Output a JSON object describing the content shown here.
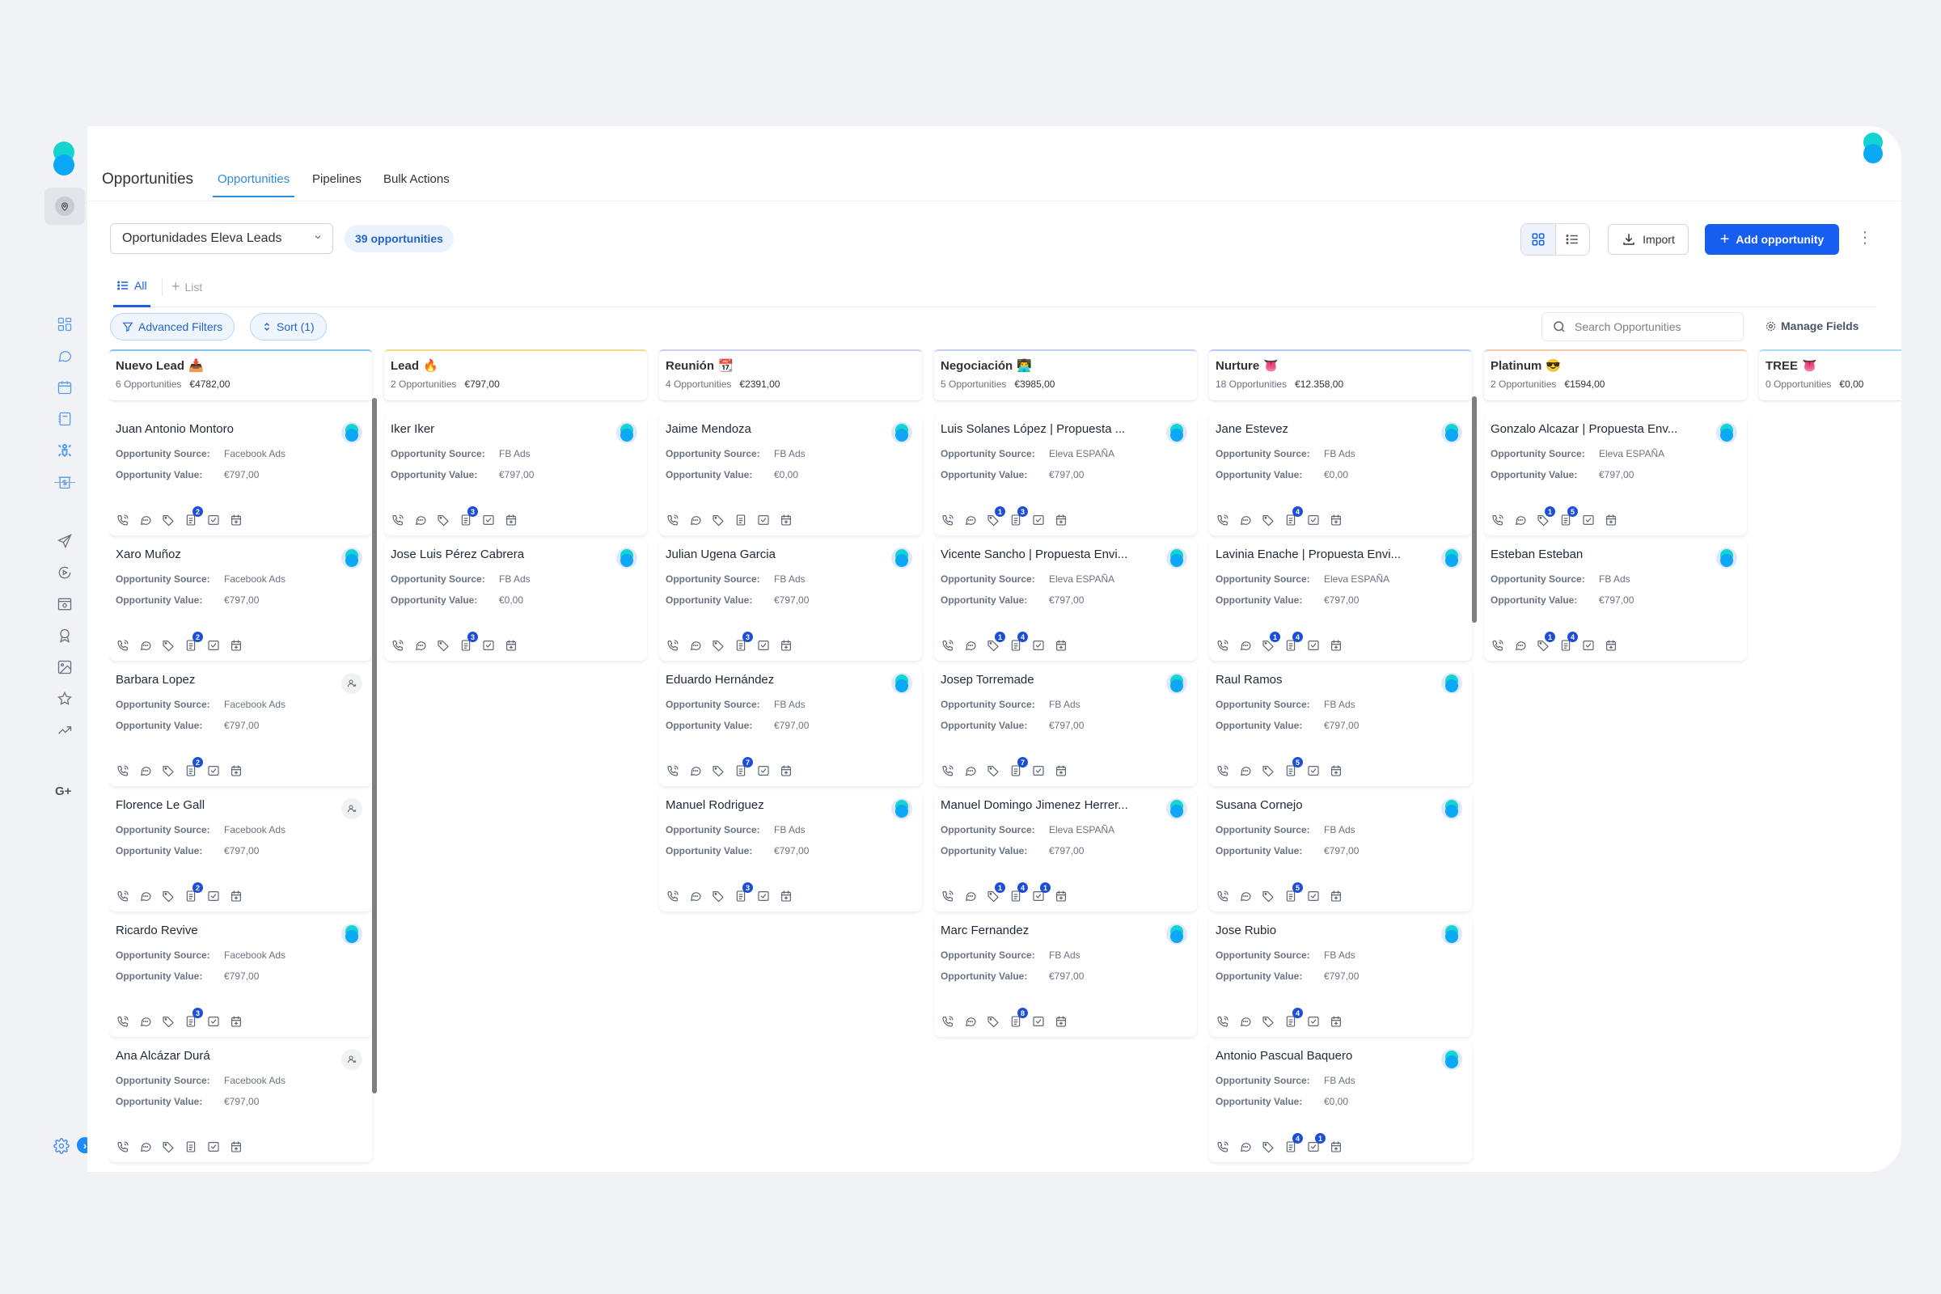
{
  "app": {
    "page_title": "Opportunities",
    "tabs": [
      {
        "label": "Opportunities",
        "active": true
      },
      {
        "label": "Pipelines",
        "active": false
      },
      {
        "label": "Bulk Actions",
        "active": false
      }
    ]
  },
  "sidebar": {
    "items": [
      {
        "icon": "dashboard-icon",
        "group": "primary"
      },
      {
        "icon": "conversations-icon",
        "group": "primary"
      },
      {
        "icon": "calendar-icon",
        "group": "primary"
      },
      {
        "icon": "contacts-icon",
        "group": "primary"
      },
      {
        "icon": "opportunities-icon",
        "group": "primary",
        "active": true
      },
      {
        "icon": "payments-icon",
        "group": "primary"
      },
      {
        "icon": "send-icon",
        "group": "secondary"
      },
      {
        "icon": "automation-icon",
        "group": "secondary"
      },
      {
        "icon": "sites-icon",
        "group": "secondary"
      },
      {
        "icon": "memberships-icon",
        "group": "secondary"
      },
      {
        "icon": "media-icon",
        "group": "secondary"
      },
      {
        "icon": "reputation-icon",
        "group": "secondary"
      },
      {
        "icon": "reporting-icon",
        "group": "secondary"
      }
    ],
    "gplus_label": "G+"
  },
  "toolbar": {
    "pipeline_selected": "Oportunidades Eleva Leads",
    "opportunity_count": "39 opportunities",
    "import_label": "Import",
    "add_label": "Add opportunity"
  },
  "subtabs": {
    "all_label": "All",
    "list_label": "List"
  },
  "filters": {
    "advanced_label": "Advanced Filters",
    "sort_label": "Sort (1)",
    "search_placeholder": "Search Opportunities",
    "search_value": "",
    "manage_fields_label": "Manage Fields"
  },
  "labels": {
    "source": "Opportunity Source:",
    "value": "Opportunity Value:"
  },
  "colors": {
    "accent": "#155eef",
    "tab_active": "#2f8cd8",
    "badge": "#1d4ed8"
  },
  "columns": [
    {
      "title": "Nuevo Lead",
      "emoji": "📥",
      "count": "6 Opportunities",
      "amount": "€4782,00",
      "border": "#7cc8f0",
      "scroll": true,
      "cards": [
        {
          "name": "Juan Antonio Montoro",
          "source": "Facebook Ads",
          "value": "€797,00",
          "assigned": true,
          "badges": {
            "notes": "2"
          }
        },
        {
          "name": "Xaro Muñoz",
          "source": "Facebook Ads",
          "value": "€797,00",
          "assigned": true,
          "badges": {
            "notes": "2"
          }
        },
        {
          "name": "Barbara Lopez",
          "source": "Facebook Ads",
          "value": "€797,00",
          "assigned": false,
          "badges": {
            "notes": "2"
          }
        },
        {
          "name": "Florence Le Gall",
          "source": "Facebook Ads",
          "value": "€797,00",
          "assigned": false,
          "badges": {
            "notes": "2"
          }
        },
        {
          "name": "Ricardo Revive",
          "source": "Facebook Ads",
          "value": "€797,00",
          "assigned": true,
          "badges": {
            "notes": "3"
          }
        },
        {
          "name": "Ana Alcázar Durá",
          "source": "Facebook Ads",
          "value": "€797,00",
          "assigned": false,
          "badges": {}
        }
      ]
    },
    {
      "title": "Lead",
      "emoji": "🔥",
      "count": "2 Opportunities",
      "amount": "€797,00",
      "border": "#f7d98a",
      "cards": [
        {
          "name": "Iker Iker",
          "source": "FB Ads",
          "value": "€797,00",
          "assigned": true,
          "badges": {
            "notes": "3"
          }
        },
        {
          "name": "Jose Luis Pérez Cabrera",
          "source": "FB Ads",
          "value": "€0,00",
          "assigned": true,
          "badges": {
            "notes": "3"
          }
        }
      ]
    },
    {
      "title": "Reunión",
      "emoji": "📆",
      "count": "4 Opportunities",
      "amount": "€2391,00",
      "border": "#c9cdf2",
      "cards": [
        {
          "name": "Jaime Mendoza",
          "source": "FB Ads",
          "value": "€0,00",
          "assigned": true,
          "badges": {}
        },
        {
          "name": "Julian Ugena Garcia",
          "source": "FB Ads",
          "value": "€797,00",
          "assigned": true,
          "badges": {
            "notes": "3"
          }
        },
        {
          "name": "Eduardo Hernández",
          "source": "FB Ads",
          "value": "€797,00",
          "assigned": true,
          "badges": {
            "notes": "7"
          }
        },
        {
          "name": "Manuel Rodriguez",
          "source": "FB Ads",
          "value": "€797,00",
          "assigned": true,
          "badges": {
            "notes": "3"
          }
        }
      ]
    },
    {
      "title": "Negociación",
      "emoji": "👨‍💻",
      "count": "5 Opportunities",
      "amount": "€3985,00",
      "border": "#c5cdf3",
      "cards": [
        {
          "name": "Luis Solanes López | Propuesta ...",
          "source": "Eleva ESPAÑA",
          "value": "€797,00",
          "assigned": true,
          "badges": {
            "tags": "1",
            "notes": "3"
          }
        },
        {
          "name": "Vicente Sancho | Propuesta Envi...",
          "source": "Eleva ESPAÑA",
          "value": "€797,00",
          "assigned": true,
          "badges": {
            "tags": "1",
            "notes": "4"
          }
        },
        {
          "name": "Josep Torremade",
          "source": "FB Ads",
          "value": "€797,00",
          "assigned": true,
          "badges": {
            "notes": "7"
          }
        },
        {
          "name": "Manuel Domingo Jimenez Herrer...",
          "source": "Eleva ESPAÑA",
          "value": "€797,00",
          "assigned": true,
          "badges": {
            "tags": "1",
            "notes": "4",
            "tasks": "1"
          }
        },
        {
          "name": "Marc Fernandez",
          "source": "FB Ads",
          "value": "€797,00",
          "assigned": true,
          "badges": {
            "notes": "8"
          }
        }
      ]
    },
    {
      "title": "Nurture",
      "emoji": "👅",
      "count": "18 Opportunities",
      "amount": "€12.358,00",
      "border": "#b7c8f5",
      "scroll": true,
      "cards": [
        {
          "name": "Jane Estevez",
          "source": "FB Ads",
          "value": "€0,00",
          "assigned": true,
          "badges": {
            "notes": "4"
          }
        },
        {
          "name": "Lavinia Enache | Propuesta Envi...",
          "source": "Eleva ESPAÑA",
          "value": "€797,00",
          "assigned": true,
          "badges": {
            "tags": "1",
            "notes": "4"
          }
        },
        {
          "name": "Raul Ramos",
          "source": "FB Ads",
          "value": "€797,00",
          "assigned": true,
          "badges": {
            "notes": "5"
          }
        },
        {
          "name": "Susana Cornejo",
          "source": "FB Ads",
          "value": "€797,00",
          "assigned": true,
          "badges": {
            "notes": "5"
          }
        },
        {
          "name": "Jose Rubio",
          "source": "FB Ads",
          "value": "€797,00",
          "assigned": true,
          "badges": {
            "notes": "4"
          }
        },
        {
          "name": "Antonio Pascual Baquero",
          "source": "FB Ads",
          "value": "€0,00",
          "assigned": true,
          "badges": {
            "notes": "4",
            "tasks": "1"
          }
        }
      ]
    },
    {
      "title": "Platinum",
      "emoji": "😎",
      "count": "2 Opportunities",
      "amount": "€1594,00",
      "border": "#f5c9a8",
      "cards": [
        {
          "name": "Gonzalo Alcazar | Propuesta Env...",
          "source": "Eleva ESPAÑA",
          "value": "€797,00",
          "assigned": true,
          "badges": {
            "tags": "1",
            "notes": "5"
          }
        },
        {
          "name": "Esteban Esteban",
          "source": "FB Ads",
          "value": "€797,00",
          "assigned": true,
          "badges": {
            "tags": "1",
            "notes": "4"
          }
        }
      ]
    },
    {
      "title": "TREE",
      "emoji": "👅",
      "count": "0 Opportunities",
      "amount": "€0,00",
      "border": "#a8dcf5",
      "cards": []
    }
  ]
}
